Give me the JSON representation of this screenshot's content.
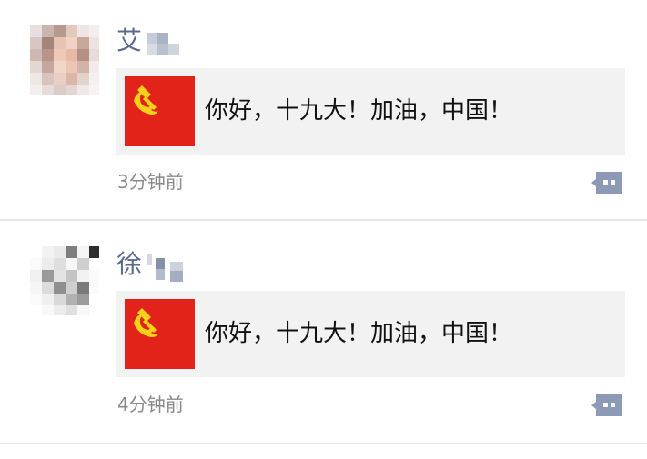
{
  "posts": [
    {
      "author_visible": "艾",
      "share_text": "你好，十九大！加油，中国！",
      "time": "3分钟前",
      "avatar_icon": "pixelated-avatar",
      "thumb_icon": "red-flag-icon",
      "comment_icon": "comment-bubble-icon"
    },
    {
      "author_visible": "徐",
      "share_text": "你好，十九大！加油，中国！",
      "time": "4分钟前",
      "avatar_icon": "pixelated-avatar",
      "thumb_icon": "red-flag-icon",
      "comment_icon": "comment-bubble-icon"
    }
  ],
  "colors": {
    "name": "#5a6a8c",
    "flag_red": "#e2231a",
    "flag_gold": "#f7d117",
    "comment_icon": "#8c9ab6",
    "card_bg": "#f2f2f2",
    "timestamp": "#8a8a8a"
  }
}
